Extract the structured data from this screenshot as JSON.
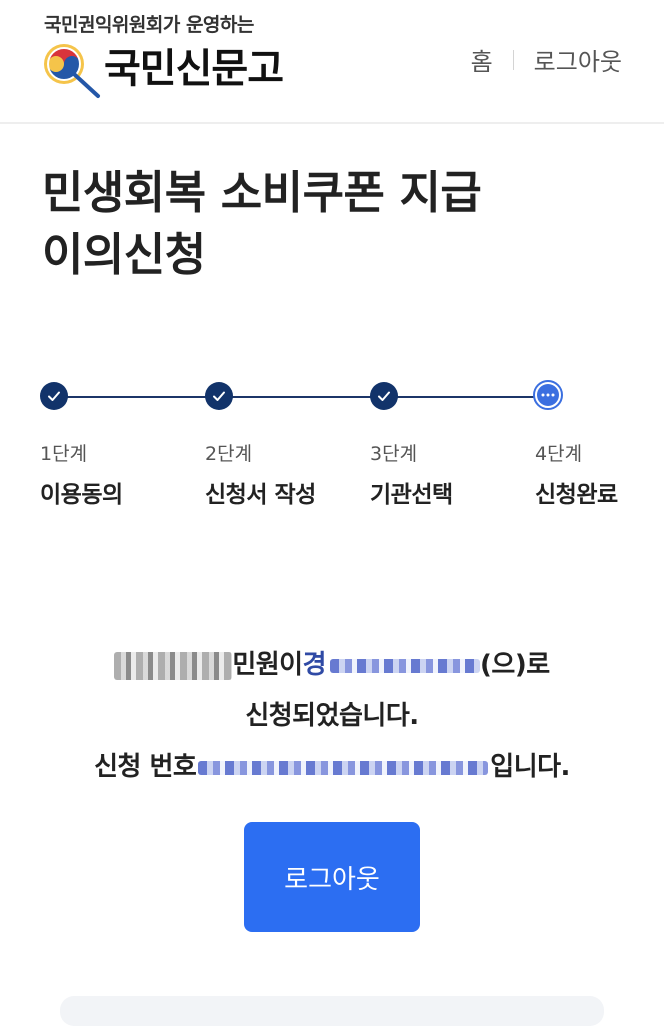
{
  "header": {
    "tagline": "국민권익위원회가 운영하는",
    "logo_text": "국민신문고",
    "nav": {
      "home": "홈",
      "logout": "로그아웃"
    }
  },
  "page": {
    "title_line1": "민생회복 소비쿠폰 지급",
    "title_line2": "이의신청"
  },
  "stepper": {
    "steps": [
      {
        "num": "1단계",
        "name": "이용동의",
        "status": "done"
      },
      {
        "num": "2단계",
        "name": "신청서 작성",
        "status": "done"
      },
      {
        "num": "3단계",
        "name": "기관선택",
        "status": "done"
      },
      {
        "num": "4단계",
        "name": "신청완료",
        "status": "current"
      }
    ]
  },
  "result": {
    "line1_mid": " 민원이 ",
    "line1_org_start": "경",
    "line1_end": "(으)로",
    "line2": "신청되었습니다.",
    "line3_start": "신청 번호",
    "line3_end": "입니다."
  },
  "actions": {
    "logout_button": "로그아웃"
  },
  "colors": {
    "primary": "#2c6ef2",
    "step_done": "#12336a",
    "step_current": "#3b6fe0",
    "org_text": "#2f4aa5"
  }
}
